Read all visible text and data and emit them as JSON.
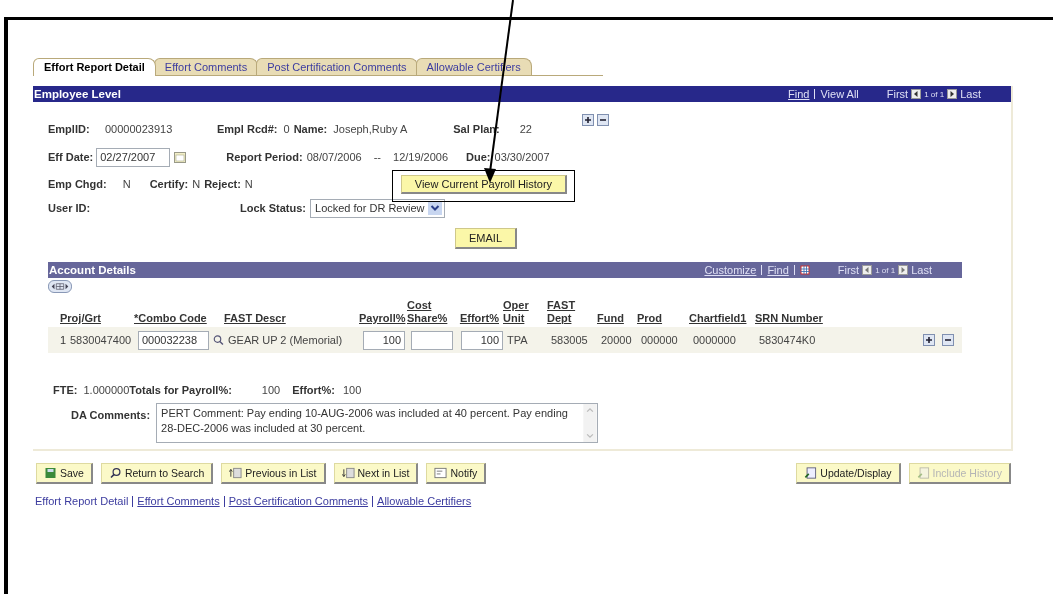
{
  "tabs": [
    {
      "label": "Effort Report Detail",
      "selected": true
    },
    {
      "label": "Effort Comments",
      "selected": false
    },
    {
      "label": "Post Certification Comments",
      "selected": false
    },
    {
      "label": "Allowable Certifiers",
      "selected": false
    }
  ],
  "employee_level": {
    "title": "Employee Level",
    "find": "Find",
    "view_all": "View All",
    "first": "First",
    "count": "1 of 1",
    "last": "Last",
    "emplid_label": "EmplID:",
    "emplid": "00000023913",
    "empl_rcd_label": "Empl Rcd#:",
    "empl_rcd": "0",
    "name_label": "Name:",
    "name": "Joseph,Ruby A",
    "sal_plan_label": "Sal Plan:",
    "sal_plan": "22",
    "eff_date_label": "Eff Date:",
    "eff_date": "02/27/2007",
    "report_period_label": "Report Period:",
    "period_start": "08/07/2006",
    "period_dash": "--",
    "period_end": "12/19/2006",
    "due_label": "Due:",
    "due": "03/30/2007",
    "emp_chgd_label": "Emp Chgd:",
    "emp_chgd": "N",
    "certify_label": "Certify:",
    "certify": "N",
    "reject_label": "Reject:",
    "reject": "N",
    "user_id_label": "User ID:",
    "lock_status_label": "Lock Status:",
    "lock_status": "Locked for DR Review",
    "payroll_history_button": "View Current Payroll History",
    "email_button": "EMAIL"
  },
  "account_details": {
    "title": "Account Details",
    "customize": "Customize",
    "find": "Find",
    "first": "First",
    "count": "1 of 1",
    "last": "Last",
    "columns": [
      {
        "label": "Proj/Grt"
      },
      {
        "label": "*Combo Code"
      },
      {
        "label": "FAST Descr"
      },
      {
        "label": "Payroll%"
      },
      {
        "label": "Cost Share%"
      },
      {
        "label": "Effort%"
      },
      {
        "label": "Oper Unit"
      },
      {
        "label": "FAST Dept"
      },
      {
        "label": "Fund"
      },
      {
        "label": "Prod"
      },
      {
        "label": "Chartfield1"
      },
      {
        "label": "SRN Number"
      }
    ],
    "rows": [
      {
        "row_number": "1",
        "cells": [
          {
            "kind": "text",
            "value": "5830047400"
          },
          {
            "kind": "lookup",
            "value": "000032238"
          },
          {
            "kind": "text",
            "value": "GEAR UP 2 (Memorial)"
          },
          {
            "kind": "input",
            "value": "100"
          },
          {
            "kind": "input"
          },
          {
            "kind": "input",
            "value": "100"
          },
          {
            "kind": "text",
            "value": "TPA"
          },
          {
            "kind": "text",
            "value": "583005"
          },
          {
            "kind": "text",
            "value": "20000"
          },
          {
            "kind": "text",
            "value": "000000"
          },
          {
            "kind": "text",
            "value": "0000000"
          },
          {
            "kind": "text",
            "value": "5830474K0"
          }
        ]
      }
    ]
  },
  "totals": {
    "fte_label": "FTE:",
    "fte": "1.000000",
    "payroll_label": "Totals for Payroll%:",
    "payroll": "100",
    "effort_label": "Effort%:",
    "effort": "100",
    "comments_label": "DA Comments:",
    "comments": "PERT Comment: Pay ending 10-AUG-2006 was included at 40 percent. Pay ending 28-DEC-2006 was included at 30 percent."
  },
  "buttons_left": [
    {
      "label": "Save",
      "kind": "save",
      "disabled": false
    },
    {
      "label": "Return to Search",
      "kind": "search",
      "disabled": false
    },
    {
      "label": "Previous in List",
      "kind": "prev",
      "disabled": false
    },
    {
      "label": "Next in List",
      "kind": "next",
      "disabled": false
    },
    {
      "label": "Notify",
      "kind": "notify",
      "disabled": false
    }
  ],
  "buttons_right": [
    {
      "label": "Update/Display",
      "kind": "refresh",
      "disabled": false
    },
    {
      "label": "Include History",
      "kind": "refresh",
      "disabled": true
    }
  ],
  "footer_links": [
    {
      "label": "Effort Report Detail",
      "selected": true
    },
    {
      "label": "Effort Comments",
      "selected": false
    },
    {
      "label": "Post Certification Comments",
      "selected": false
    },
    {
      "label": "Allowable Certifiers",
      "selected": false
    }
  ]
}
